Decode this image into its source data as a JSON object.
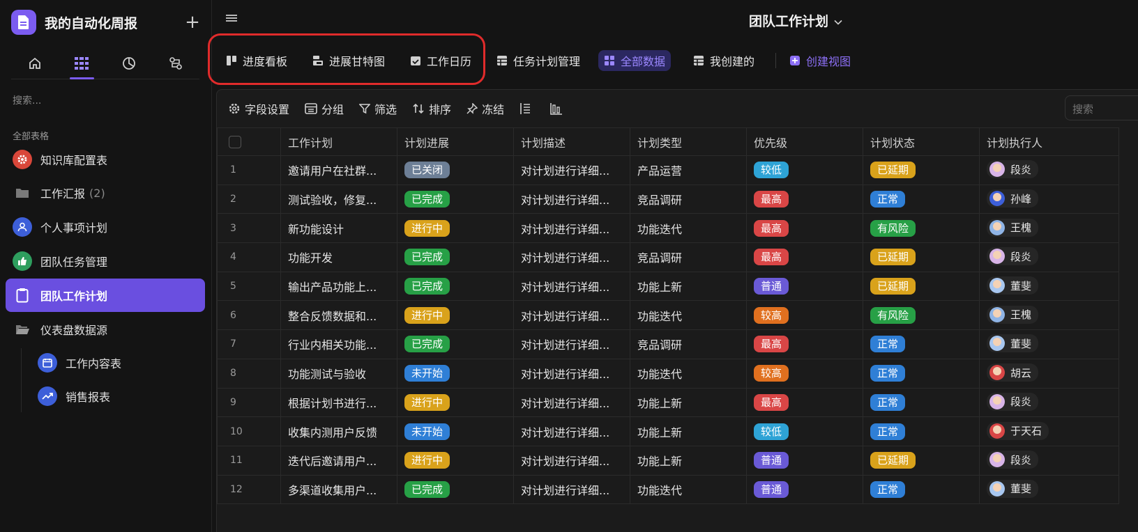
{
  "app": {
    "title": "我的自动化周报",
    "add_label": "+"
  },
  "sidebar": {
    "search_placeholder": "搜索...",
    "section_label": "全部表格",
    "items": [
      {
        "label": "知识库配置表",
        "icon": "gear-icon",
        "color": "#d9473a"
      },
      {
        "label": "工作汇报",
        "count": "(2)",
        "icon": "folder-icon",
        "color": "#555555"
      },
      {
        "label": "个人事项计划",
        "icon": "person-icon",
        "color": "#3d5fd9"
      },
      {
        "label": "团队任务管理",
        "icon": "thumbs-up-icon",
        "color": "#2e9e5e"
      },
      {
        "label": "团队工作计划",
        "icon": "clipboard-icon",
        "color": "#6a4fe0"
      },
      {
        "label": "仪表盘数据源",
        "icon": "folder-open-icon",
        "color": "#555555"
      }
    ],
    "sub_items": [
      {
        "label": "工作内容表",
        "icon": "calendar-icon"
      },
      {
        "label": "销售报表",
        "icon": "trend-icon"
      }
    ]
  },
  "header": {
    "title": "团队工作计划"
  },
  "views": [
    {
      "label": "进度看板",
      "icon": "kanban-icon"
    },
    {
      "label": "进展甘特图",
      "icon": "gantt-icon"
    },
    {
      "label": "工作日历",
      "icon": "calendar-check-icon"
    },
    {
      "label": "任务计划管理",
      "icon": "grid-icon"
    },
    {
      "label": "全部数据",
      "icon": "grid4-icon",
      "active": true
    },
    {
      "label": "我创建的",
      "icon": "grid-icon"
    },
    {
      "label": "创建视图",
      "icon": "plus-square-icon"
    }
  ],
  "toolbar": {
    "field_settings": "字段设置",
    "group": "分组",
    "filter": "筛选",
    "sort": "排序",
    "freeze": "冻结",
    "search_placeholder": "搜索"
  },
  "table": {
    "columns": [
      "工作计划",
      "计划进展",
      "计划描述",
      "计划类型",
      "优先级",
      "计划状态",
      "计划执行人"
    ],
    "rows": [
      {
        "idx": "1",
        "plan": "邀请用户在社群...",
        "progress": "已关闭",
        "desc": "对计划进行详细...",
        "type": "产品运营",
        "priority": "较低",
        "status": "已延期",
        "owner": "段炎"
      },
      {
        "idx": "2",
        "plan": "测试验收，修复...",
        "progress": "已完成",
        "desc": "对计划进行详细...",
        "type": "竞品调研",
        "priority": "最高",
        "status": "正常",
        "owner": "孙峰"
      },
      {
        "idx": "3",
        "plan": "新功能设计",
        "progress": "进行中",
        "desc": "对计划进行详细...",
        "type": "功能迭代",
        "priority": "最高",
        "status": "有风险",
        "owner": "王槐"
      },
      {
        "idx": "4",
        "plan": "功能开发",
        "progress": "已完成",
        "desc": "对计划进行详细...",
        "type": "竞品调研",
        "priority": "最高",
        "status": "已延期",
        "owner": "段炎"
      },
      {
        "idx": "5",
        "plan": "输出产品功能上...",
        "progress": "已完成",
        "desc": "对计划进行详细...",
        "type": "功能上新",
        "priority": "普通",
        "status": "已延期",
        "owner": "董斐"
      },
      {
        "idx": "6",
        "plan": "整合反馈数据和...",
        "progress": "进行中",
        "desc": "对计划进行详细...",
        "type": "功能迭代",
        "priority": "较高",
        "status": "有风险",
        "owner": "王槐"
      },
      {
        "idx": "7",
        "plan": "行业内相关功能...",
        "progress": "已完成",
        "desc": "对计划进行详细...",
        "type": "竞品调研",
        "priority": "最高",
        "status": "正常",
        "owner": "董斐"
      },
      {
        "idx": "8",
        "plan": "功能测试与验收",
        "progress": "未开始",
        "desc": "对计划进行详细...",
        "type": "功能迭代",
        "priority": "较高",
        "status": "正常",
        "owner": "胡云"
      },
      {
        "idx": "9",
        "plan": "根据计划书进行...",
        "progress": "进行中",
        "desc": "对计划进行详细...",
        "type": "功能上新",
        "priority": "最高",
        "status": "正常",
        "owner": "段炎"
      },
      {
        "idx": "10",
        "plan": "收集内测用户反馈",
        "progress": "未开始",
        "desc": "对计划进行详细...",
        "type": "功能上新",
        "priority": "较低",
        "status": "正常",
        "owner": "于天石"
      },
      {
        "idx": "11",
        "plan": "迭代后邀请用户...",
        "progress": "进行中",
        "desc": "对计划进行详细...",
        "type": "功能上新",
        "priority": "普通",
        "status": "已延期",
        "owner": "段炎"
      },
      {
        "idx": "12",
        "plan": "多渠道收集用户...",
        "progress": "已完成",
        "desc": "对计划进行详细...",
        "type": "功能迭代",
        "priority": "普通",
        "status": "正常",
        "owner": "董斐"
      }
    ]
  },
  "colors": {
    "已关闭": "#6d7f96",
    "已完成": "#27a046",
    "进行中": "#d9a21b",
    "未开始": "#2f7fd6",
    "较低": "#2ea3d6",
    "最高": "#d94646",
    "普通": "#6a5ad6",
    "较高": "#e0701f",
    "已延期": "#d9a21b",
    "正常": "#2f7fd6",
    "有风险": "#27a046",
    "accent": "#7b5cf0",
    "highlight": "#e02b2b"
  },
  "avatar_colors": {
    "段炎": "#d8b4e8",
    "孙峰": "#3d5fd9",
    "王槐": "#8fb4e6",
    "董斐": "#a8c7f0",
    "胡云": "#d94646",
    "于天石": "#d94646"
  }
}
